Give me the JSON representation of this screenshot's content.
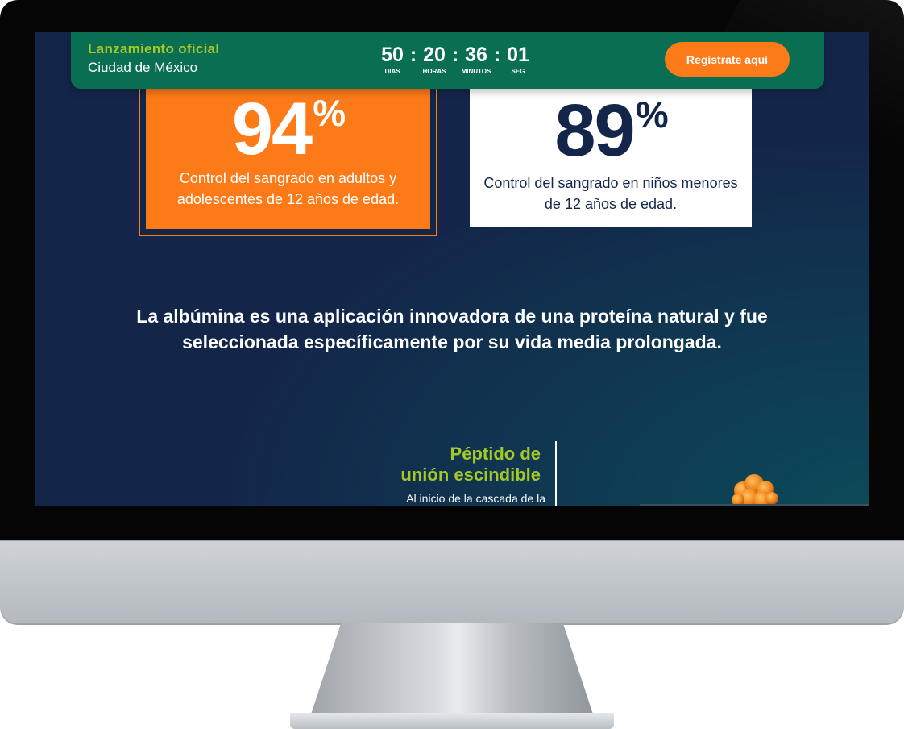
{
  "header": {
    "event_label": "Lanzamiento oficial",
    "event_city": "Ciudad de México",
    "countdown": [
      {
        "value": "50",
        "label": "DIAS"
      },
      {
        "value": "20",
        "label": "HORAS"
      },
      {
        "value": "36",
        "label": "MINUTOS"
      },
      {
        "value": "01",
        "label": "SEG"
      }
    ],
    "separator": ":",
    "register_label": "Regístrate aquí"
  },
  "stats": [
    {
      "value": "94",
      "unit": "%",
      "description": "Control del sangrado en adultos y adolescentes de 12 años de edad."
    },
    {
      "value": "89",
      "unit": "%",
      "description": "Control del sangrado en niños menores de 12 años de edad."
    }
  ],
  "statement": "La albúmina es una aplicación innovadora de una proteína natural y fue seleccionada específicamente por su vida media prolongada.",
  "peptide": {
    "title_line1": "Péptido de",
    "title_line2": "unión escindible",
    "text": "Al inicio de la cascada de la"
  },
  "colors": {
    "navy": "#13264a",
    "green_bar": "#0a6e52",
    "lime": "#a6c827",
    "orange": "#fd7a18"
  },
  "icons": {
    "molecule": "molecule-icon"
  }
}
